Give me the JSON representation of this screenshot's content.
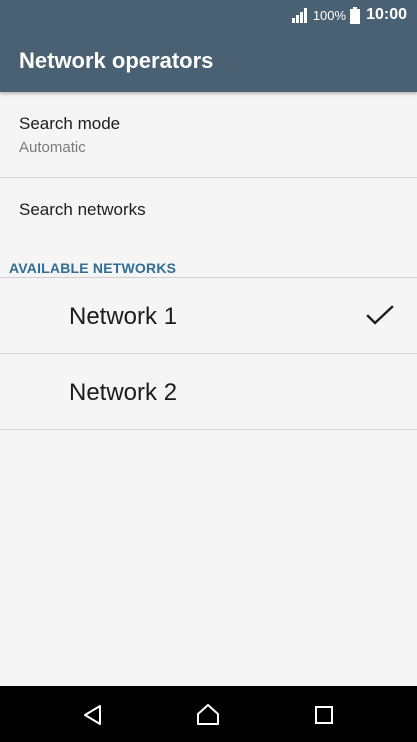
{
  "status_bar": {
    "battery_percent": "100%",
    "time": "10:00"
  },
  "app_bar": {
    "title": "Network operators"
  },
  "settings": {
    "search_mode": {
      "title": "Search mode",
      "value": "Automatic"
    },
    "search_networks": {
      "title": "Search networks"
    }
  },
  "available_networks": {
    "header": "AVAILABLE NETWORKS",
    "items": [
      {
        "label": "Network 1",
        "selected": true
      },
      {
        "label": "Network 2",
        "selected": false
      }
    ]
  },
  "icons": {
    "signal": "signal-icon",
    "battery": "battery-icon",
    "check": "check-icon",
    "back": "back-icon",
    "home": "home-icon",
    "recents": "recents-icon"
  },
  "colors": {
    "app_bar": "#4a6173",
    "section_header": "#2f6c96",
    "background": "#f5f5f5"
  }
}
